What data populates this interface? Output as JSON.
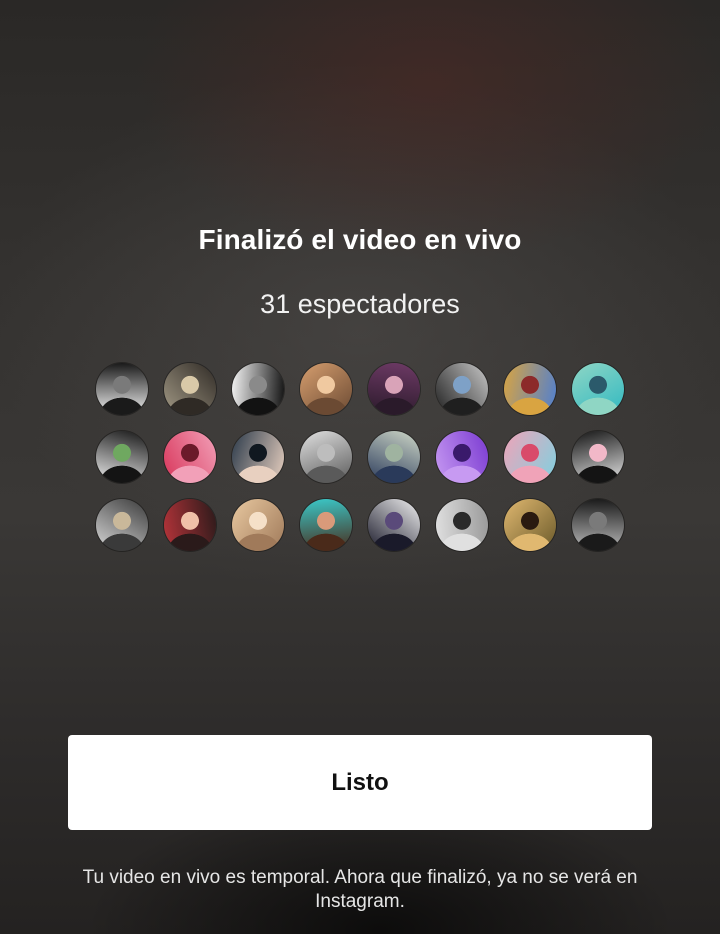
{
  "live_end": {
    "title": "Finalizó el video en vivo",
    "viewers_count": "31 espectadores",
    "done_button_label": "Listo",
    "footer_note": "Tu video en vivo es temporal. Ahora que finalizó, ya no se verá en Instagram."
  },
  "viewers": {
    "avatars": [
      {
        "name": "viewer-avatar-1",
        "colors": [
          "#f2f2f2",
          "#1a1a1a",
          "#7a7a7a"
        ]
      },
      {
        "name": "viewer-avatar-2",
        "colors": [
          "#a39a86",
          "#2f2a25",
          "#d9c9a8"
        ]
      },
      {
        "name": "viewer-avatar-3",
        "colors": [
          "#f5f5f5",
          "#121212",
          "#8a8a8a"
        ]
      },
      {
        "name": "viewer-avatar-4",
        "colors": [
          "#d79f6f",
          "#6b4a33",
          "#f0c9a0"
        ]
      },
      {
        "name": "viewer-avatar-5",
        "colors": [
          "#6e3a66",
          "#2a1a2a",
          "#d9a3b8"
        ]
      },
      {
        "name": "viewer-avatar-6",
        "colors": [
          "#c9c9c9",
          "#1f1f1f",
          "#7ea1c7"
        ]
      },
      {
        "name": "viewer-avatar-7",
        "colors": [
          "#4f7fd1",
          "#d9a441",
          "#8c2a2a"
        ]
      },
      {
        "name": "viewer-avatar-8",
        "colors": [
          "#31b9c2",
          "#8fd6c4",
          "#2b5a6b"
        ]
      },
      {
        "name": "viewer-avatar-9",
        "colors": [
          "#f0f0f0",
          "#141414",
          "#6fa860"
        ]
      },
      {
        "name": "viewer-avatar-10",
        "colors": [
          "#d8355a",
          "#f2a0b8",
          "#6b1a2a"
        ]
      },
      {
        "name": "viewer-avatar-11",
        "colors": [
          "#2b3a4a",
          "#e8d0c0",
          "#101820"
        ]
      },
      {
        "name": "viewer-avatar-12",
        "colors": [
          "#e0e0e0",
          "#5a5a5a",
          "#bdbdbd"
        ]
      },
      {
        "name": "viewer-avatar-13",
        "colors": [
          "#cfd8c8",
          "#2a3a5a",
          "#9fb3a0"
        ]
      },
      {
        "name": "viewer-avatar-14",
        "colors": [
          "#7a3ad1",
          "#c79af2",
          "#3a1a6b"
        ]
      },
      {
        "name": "viewer-avatar-15",
        "colors": [
          "#7fd1e0",
          "#f0a3b8",
          "#d94a6a"
        ]
      },
      {
        "name": "viewer-avatar-16",
        "colors": [
          "#e8e8e8",
          "#141414",
          "#f2b8c8"
        ]
      },
      {
        "name": "viewer-avatar-17",
        "colors": [
          "#d9d9d9",
          "#3a3a3a",
          "#c9b89a"
        ]
      },
      {
        "name": "viewer-avatar-18",
        "colors": [
          "#b8343a",
          "#2a1a1a",
          "#f0c0a8"
        ]
      },
      {
        "name": "viewer-avatar-19",
        "colors": [
          "#e8c8a0",
          "#a07a5a",
          "#f5e0c8"
        ]
      },
      {
        "name": "viewer-avatar-20",
        "colors": [
          "#3ac9c9",
          "#4a2a1a",
          "#d99a7a"
        ]
      },
      {
        "name": "viewer-avatar-21",
        "colors": [
          "#f2f2f2",
          "#1a1a2a",
          "#5a4a7a"
        ]
      },
      {
        "name": "viewer-avatar-22",
        "colors": [
          "#9a9a9a",
          "#e0e0e0",
          "#2a2a2a"
        ]
      },
      {
        "name": "viewer-avatar-23",
        "colors": [
          "#6b5a2a",
          "#e0b870",
          "#2a1a10"
        ]
      },
      {
        "name": "viewer-avatar-24",
        "colors": [
          "#bdbdbd",
          "#1a1a1a",
          "#7a7a7a"
        ]
      }
    ]
  }
}
